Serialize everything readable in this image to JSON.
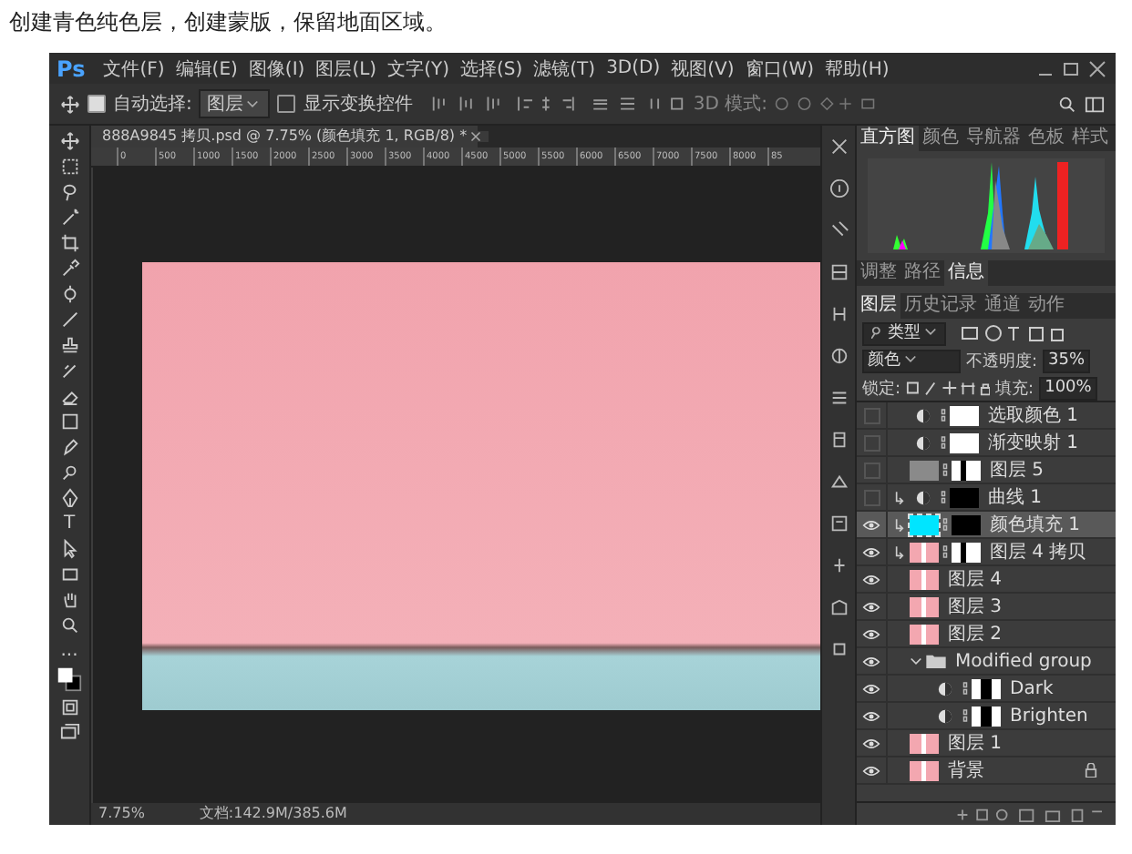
{
  "heading": "创建青色纯色层，创建蒙版，保留地面区域。",
  "app": {
    "logo": "Ps",
    "menu": [
      "文件(F)",
      "编辑(E)",
      "图像(I)",
      "图层(L)",
      "文字(Y)",
      "选择(S)",
      "滤镜(T)",
      "3D(D)",
      "视图(V)",
      "窗口(W)",
      "帮助(H)"
    ]
  },
  "options": {
    "auto_select": {
      "label": "自动选择:",
      "checked": true
    },
    "target": "图层",
    "transform": {
      "label": "显示变换控件",
      "checked": false
    },
    "mode_3d": "3D 模式:"
  },
  "document": {
    "tab": "888A9845 拷贝.psd @ 7.75% (颜色填充 1, RGB/8) *",
    "ruler": [
      "0",
      "500",
      "1000",
      "1500",
      "2000",
      "2500",
      "3000",
      "3500",
      "4000",
      "4500",
      "5000",
      "5500",
      "6000",
      "6500",
      "7000",
      "7500",
      "8000",
      "85"
    ],
    "zoom": "7.75%",
    "info": "文档:142.9M/385.6M"
  },
  "tools": [
    {
      "kind": "move"
    },
    {
      "kind": "marquee"
    },
    {
      "kind": "lasso"
    },
    {
      "kind": "wand"
    },
    {
      "kind": "crop"
    },
    {
      "kind": "eyedropper"
    },
    {
      "kind": "heal"
    },
    {
      "kind": "brush"
    },
    {
      "kind": "stamp"
    },
    {
      "kind": "history"
    },
    {
      "kind": "eraser"
    },
    {
      "kind": "gradient"
    },
    {
      "kind": "smudge"
    },
    {
      "kind": "dodge"
    },
    {
      "kind": "pen"
    },
    {
      "kind": "text",
      "glyph": "T"
    },
    {
      "kind": "select"
    },
    {
      "kind": "shape"
    },
    {
      "kind": "hand"
    },
    {
      "kind": "zoom"
    },
    {
      "kind": "more",
      "glyph": "..."
    },
    {
      "kind": "swatches"
    },
    {
      "kind": "quickmask"
    },
    {
      "kind": "screen"
    }
  ],
  "panels": {
    "top_tabs": [
      {
        "label": "直方图",
        "selected": true
      },
      {
        "label": "颜色",
        "selected": false
      },
      {
        "label": "导航器",
        "selected": false
      },
      {
        "label": "色板",
        "selected": false
      },
      {
        "label": "样式",
        "selected": false
      }
    ],
    "mid_tabs": [
      {
        "label": "调整",
        "selected": false
      },
      {
        "label": "路径",
        "selected": false
      },
      {
        "label": "信息",
        "selected": true
      }
    ],
    "layer_tabs": [
      {
        "label": "图层",
        "selected": true
      },
      {
        "label": "历史记录",
        "selected": false
      },
      {
        "label": "通道",
        "selected": false
      },
      {
        "label": "动作",
        "selected": false
      }
    ],
    "filter": "类型",
    "blend": "颜色",
    "opacity_label": "不透明度:",
    "opacity": "35%",
    "lock_label": "锁定:",
    "fill_label": "填充:",
    "fill": "100%",
    "layers": [
      {
        "name": "选取颜色 1",
        "kind": "adjust",
        "visible": false,
        "selected": false,
        "clipped": false,
        "mask": {
          "kind": "white"
        }
      },
      {
        "name": "渐变映射 1",
        "kind": "adjust",
        "visible": false,
        "selected": false,
        "clipped": false,
        "mask": {
          "kind": "white"
        }
      },
      {
        "name": "图层 5",
        "kind": "gray",
        "visible": false,
        "selected": false,
        "clipped": false,
        "mask": {
          "kind": "figure"
        }
      },
      {
        "name": "曲线 1",
        "kind": "adjust",
        "visible": false,
        "selected": false,
        "clipped": true,
        "mask": {
          "kind": "black"
        }
      },
      {
        "name": "颜色填充 1",
        "kind": "fill",
        "visible": true,
        "selected": true,
        "clipped": true,
        "mask": {
          "kind": "black"
        }
      },
      {
        "name": "图层 4 拷贝",
        "kind": "photo",
        "visible": true,
        "selected": false,
        "clipped": true,
        "mask": {
          "kind": "figure"
        }
      },
      {
        "name": "图层 4",
        "kind": "photo",
        "visible": true,
        "selected": false,
        "clipped": false
      },
      {
        "name": "图层 3",
        "kind": "photo",
        "visible": true,
        "selected": false,
        "clipped": false
      },
      {
        "name": "图层 2",
        "kind": "photo",
        "visible": true,
        "selected": false,
        "clipped": false
      },
      {
        "name": "Modified group",
        "kind": "group",
        "visible": true,
        "selected": false,
        "clipped": false,
        "expanded": true,
        "children": [
          {
            "name": "Dark",
            "kind": "adjust",
            "visible": true,
            "selected": false,
            "clipped": false,
            "mask": {
              "kind": "split"
            }
          },
          {
            "name": "Brighten",
            "kind": "adjust",
            "visible": true,
            "selected": false,
            "clipped": false,
            "mask": {
              "kind": "split"
            }
          }
        ]
      },
      {
        "name": "图层 1",
        "kind": "photo",
        "visible": true,
        "selected": false,
        "clipped": false
      },
      {
        "name": "背景",
        "kind": "photo",
        "visible": true,
        "selected": false,
        "clipped": false,
        "locked": true
      }
    ]
  }
}
